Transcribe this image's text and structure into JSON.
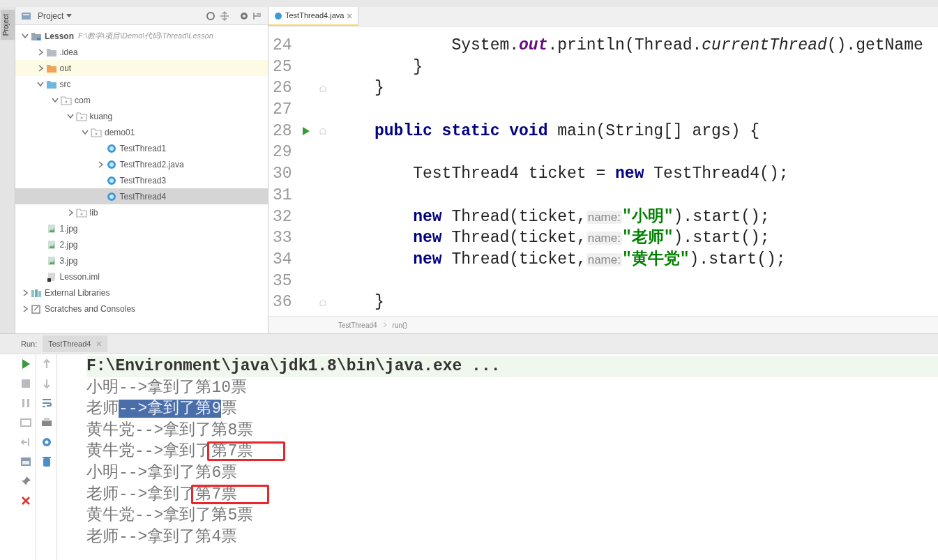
{
  "tool_stripe": {
    "label": "Project"
  },
  "project_panel": {
    "title": "Project",
    "tree": [
      {
        "label": "Lesson",
        "path": "F:\\教学\\项目\\Demo\\代码\\Thread\\Lesson",
        "kind": "module_folder",
        "expanded": true,
        "selected": false,
        "highlighted": false,
        "children": [
          {
            "label": ".idea",
            "kind": "folder",
            "expanded": false,
            "selected": false,
            "highlighted": false
          },
          {
            "label": "out",
            "kind": "excluded_folder",
            "expanded": false,
            "selected": false,
            "highlighted": true
          },
          {
            "label": "src",
            "kind": "source_folder",
            "expanded": true,
            "selected": false,
            "highlighted": false,
            "children": [
              {
                "label": "com",
                "kind": "package",
                "expanded": true,
                "selected": false,
                "highlighted": false,
                "children": [
                  {
                    "label": "kuang",
                    "kind": "package",
                    "expanded": true,
                    "selected": false,
                    "highlighted": false,
                    "children": [
                      {
                        "label": "demo01",
                        "kind": "package",
                        "expanded": true,
                        "selected": false,
                        "highlighted": false,
                        "children": [
                          {
                            "label": "TestThread1",
                            "kind": "class",
                            "selected": false,
                            "highlighted": false
                          },
                          {
                            "label": "TestThread2.java",
                            "kind": "class",
                            "expanded": false,
                            "selected": false,
                            "highlighted": false
                          },
                          {
                            "label": "TestThread3",
                            "kind": "class",
                            "selected": false,
                            "highlighted": false
                          },
                          {
                            "label": "TestThread4",
                            "kind": "class",
                            "selected": true,
                            "highlighted": false
                          }
                        ]
                      }
                    ]
                  },
                  {
                    "label": "lib",
                    "kind": "package",
                    "expanded": false,
                    "selected": false,
                    "highlighted": false
                  }
                ]
              }
            ]
          },
          {
            "label": "1.jpg",
            "kind": "image",
            "selected": false,
            "highlighted": false
          },
          {
            "label": "2.jpg",
            "kind": "image",
            "selected": false,
            "highlighted": false
          },
          {
            "label": "3.jpg",
            "kind": "image",
            "selected": false,
            "highlighted": false
          },
          {
            "label": "Lesson.iml",
            "kind": "module_file",
            "selected": false,
            "highlighted": false
          }
        ]
      },
      {
        "label": "External Libraries",
        "kind": "library",
        "expanded": false,
        "selected": false,
        "highlighted": false
      },
      {
        "label": "Scratches and Consoles",
        "kind": "scratch",
        "expanded": false,
        "selected": false,
        "highlighted": false
      }
    ]
  },
  "editor": {
    "tabs": [
      {
        "label": "TestThread4.java",
        "selected": true
      }
    ],
    "lines": [
      {
        "number": "24",
        "run": false,
        "fold": false,
        "tokens": [
          {
            "kind": "plain",
            "text": "        System."
          },
          {
            "kind": "field",
            "text": "out"
          },
          {
            "kind": "plain",
            "text": ".println(Thread."
          },
          {
            "kind": "italic",
            "text": "currentThread"
          },
          {
            "kind": "plain",
            "text": "().getName"
          }
        ]
      },
      {
        "number": "25",
        "run": false,
        "fold": false,
        "tokens": [
          {
            "kind": "plain",
            "text": "    }"
          }
        ]
      },
      {
        "number": "26",
        "run": false,
        "fold": true,
        "tokens": [
          {
            "kind": "plain",
            "text": "}"
          }
        ]
      },
      {
        "number": "27",
        "run": false,
        "fold": false
      },
      {
        "number": "28",
        "run": true,
        "fold": true,
        "tokens": [
          {
            "kind": "keyword",
            "text": "public static void"
          },
          {
            "kind": "plain",
            "text": " main(String[] args) {"
          }
        ]
      },
      {
        "number": "29",
        "run": false,
        "fold": false
      },
      {
        "number": "30",
        "run": false,
        "fold": false,
        "tokens": [
          {
            "kind": "plain",
            "text": "    TestThread4 ticket = "
          },
          {
            "kind": "keyword",
            "text": "new"
          },
          {
            "kind": "plain",
            "text": " TestThread4();"
          }
        ]
      },
      {
        "number": "31",
        "run": false,
        "fold": false
      },
      {
        "number": "32",
        "run": false,
        "fold": false,
        "tokens": [
          {
            "kind": "keyword",
            "text": "    new"
          },
          {
            "kind": "plain",
            "text": " Thread(ticket,"
          },
          {
            "kind": "hint",
            "text": "name:"
          },
          {
            "kind": "string",
            "text": "\"小明\""
          },
          {
            "kind": "plain",
            "text": ").start();"
          }
        ]
      },
      {
        "number": "33",
        "run": false,
        "fold": false,
        "tokens": [
          {
            "kind": "keyword",
            "text": "    new"
          },
          {
            "kind": "plain",
            "text": " Thread(ticket,"
          },
          {
            "kind": "hint",
            "text": "name:"
          },
          {
            "kind": "string",
            "text": "\"老师\""
          },
          {
            "kind": "plain",
            "text": ").start();"
          }
        ]
      },
      {
        "number": "34",
        "run": false,
        "fold": false,
        "tokens": [
          {
            "kind": "keyword",
            "text": "    new"
          },
          {
            "kind": "plain",
            "text": " Thread(ticket,"
          },
          {
            "kind": "hint",
            "text": "name:"
          },
          {
            "kind": "string",
            "text": "\"黄牛党\""
          },
          {
            "kind": "plain",
            "text": ").start();"
          }
        ]
      },
      {
        "number": "35",
        "run": false,
        "fold": false
      },
      {
        "number": "36",
        "run": false,
        "fold": true,
        "tokens": [
          {
            "kind": "plain",
            "text": "}"
          }
        ]
      }
    ],
    "breadcrumbs": [
      "TestThread4",
      "run()"
    ]
  },
  "run_panel": {
    "label": "Run:",
    "tabs": [
      {
        "label": "TestThread4",
        "selected": true
      }
    ],
    "console": [
      {
        "kind": "command",
        "parts": [
          {
            "text": "F:\\Environment\\java\\jdk1.8\\bin\\java.exe ...",
            "selected": false,
            "boxed": false
          }
        ]
      },
      {
        "kind": "output",
        "parts": [
          {
            "text": "小明-->拿到了第10票",
            "selected": false,
            "boxed": false
          }
        ]
      },
      {
        "kind": "output",
        "parts": [
          {
            "text": "老师",
            "selected": false,
            "boxed": false
          },
          {
            "text": "-->拿到了第9",
            "selected": true,
            "boxed": false
          },
          {
            "text": "票",
            "selected": false,
            "boxed": false
          }
        ]
      },
      {
        "kind": "output",
        "parts": [
          {
            "text": "黄牛党-->拿到了第8票",
            "selected": false,
            "boxed": false
          }
        ]
      },
      {
        "kind": "output",
        "parts": [
          {
            "text": "黄牛党-->拿到了",
            "selected": false,
            "boxed": false
          },
          {
            "text": "第7票",
            "selected": false,
            "boxed": true
          }
        ]
      },
      {
        "kind": "output",
        "parts": [
          {
            "text": "小明-->拿到了第6票",
            "selected": false,
            "boxed": false
          }
        ]
      },
      {
        "kind": "output",
        "parts": [
          {
            "text": "老师-->拿到了",
            "selected": false,
            "boxed": false
          },
          {
            "text": "第7票",
            "selected": false,
            "boxed": true
          }
        ]
      },
      {
        "kind": "output",
        "parts": [
          {
            "text": "黄牛党-->拿到了第5票",
            "selected": false,
            "boxed": false
          }
        ]
      },
      {
        "kind": "output",
        "parts": [
          {
            "text": "老师-->拿到了第4票",
            "selected": false,
            "boxed": false
          }
        ]
      }
    ]
  }
}
